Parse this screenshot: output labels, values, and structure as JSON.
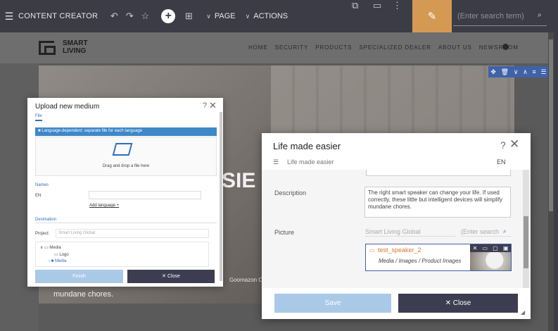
{
  "toolbar": {
    "title": "CONTENT CREATOR",
    "page_label": "PAGE",
    "actions_label": "ACTIONS",
    "search_placeholder": "(Enter search term)"
  },
  "site": {
    "logo_line1": "SMART",
    "logo_line2": "LIVING",
    "nav": [
      "HOME",
      "SECURITY",
      "PRODUCTS",
      "SPECIALIZED DEALER",
      "ABOUT US",
      "NEWSROOM"
    ],
    "hero_text": "SIE",
    "hero_bottom": "mundane chores.",
    "hero_brand": "Goomazon O"
  },
  "upload": {
    "title": "Upload new medium",
    "tab_file": "File",
    "language_option": "Language-dependent: separate file for each language",
    "drop_label": "Drag and drop a file here",
    "names_label": "Names",
    "lang_en": "EN",
    "add_language": "Add language +",
    "destination_label": "Destination",
    "project_label": "Project:",
    "project_value": "Smart Living Global",
    "tree": [
      "Media",
      "Logo",
      "Media"
    ],
    "finish": "Finish",
    "close": "Close"
  },
  "dialog": {
    "title": "Life made easier",
    "subtitle": "Life made easier",
    "language": "EN",
    "description_label": "Description",
    "description_text": "The right smart speaker can change your life. If used correctly, these little but intelligent devices will simplify mundane chores.",
    "picture_label": "Picture",
    "project_value": "Smart Living Global",
    "search_placeholder": "(Enter search",
    "asset_name": "test_speaker_2",
    "asset_path": "Media / Images / Product Images",
    "save": "Save",
    "close": "Close"
  }
}
